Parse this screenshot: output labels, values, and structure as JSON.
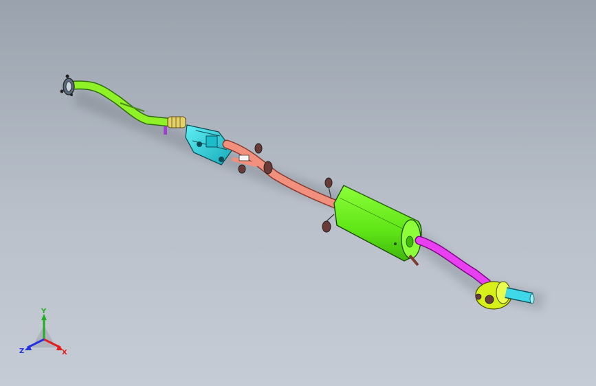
{
  "view": {
    "background_top": "#9aa2ad",
    "background_bottom": "#c6ccd5"
  },
  "model": {
    "parts": [
      {
        "name": "front-pipe",
        "color": "#8ef227"
      },
      {
        "name": "catalytic-converter",
        "color": "#2fd6e0"
      },
      {
        "name": "intermediate-pipe",
        "color": "#f2907e"
      },
      {
        "name": "main-muffler",
        "color": "#6cf21f"
      },
      {
        "name": "tail-pipe",
        "color": "#e83ff0"
      },
      {
        "name": "rear-silencer",
        "color": "#d8f01a"
      },
      {
        "name": "tail-tip",
        "color": "#3fd8e8"
      }
    ]
  },
  "triad": {
    "x_label": "X",
    "y_label": "Y",
    "z_label": "Z",
    "x_color": "#e21e1e",
    "y_color": "#22b022",
    "z_color": "#2233dd"
  }
}
